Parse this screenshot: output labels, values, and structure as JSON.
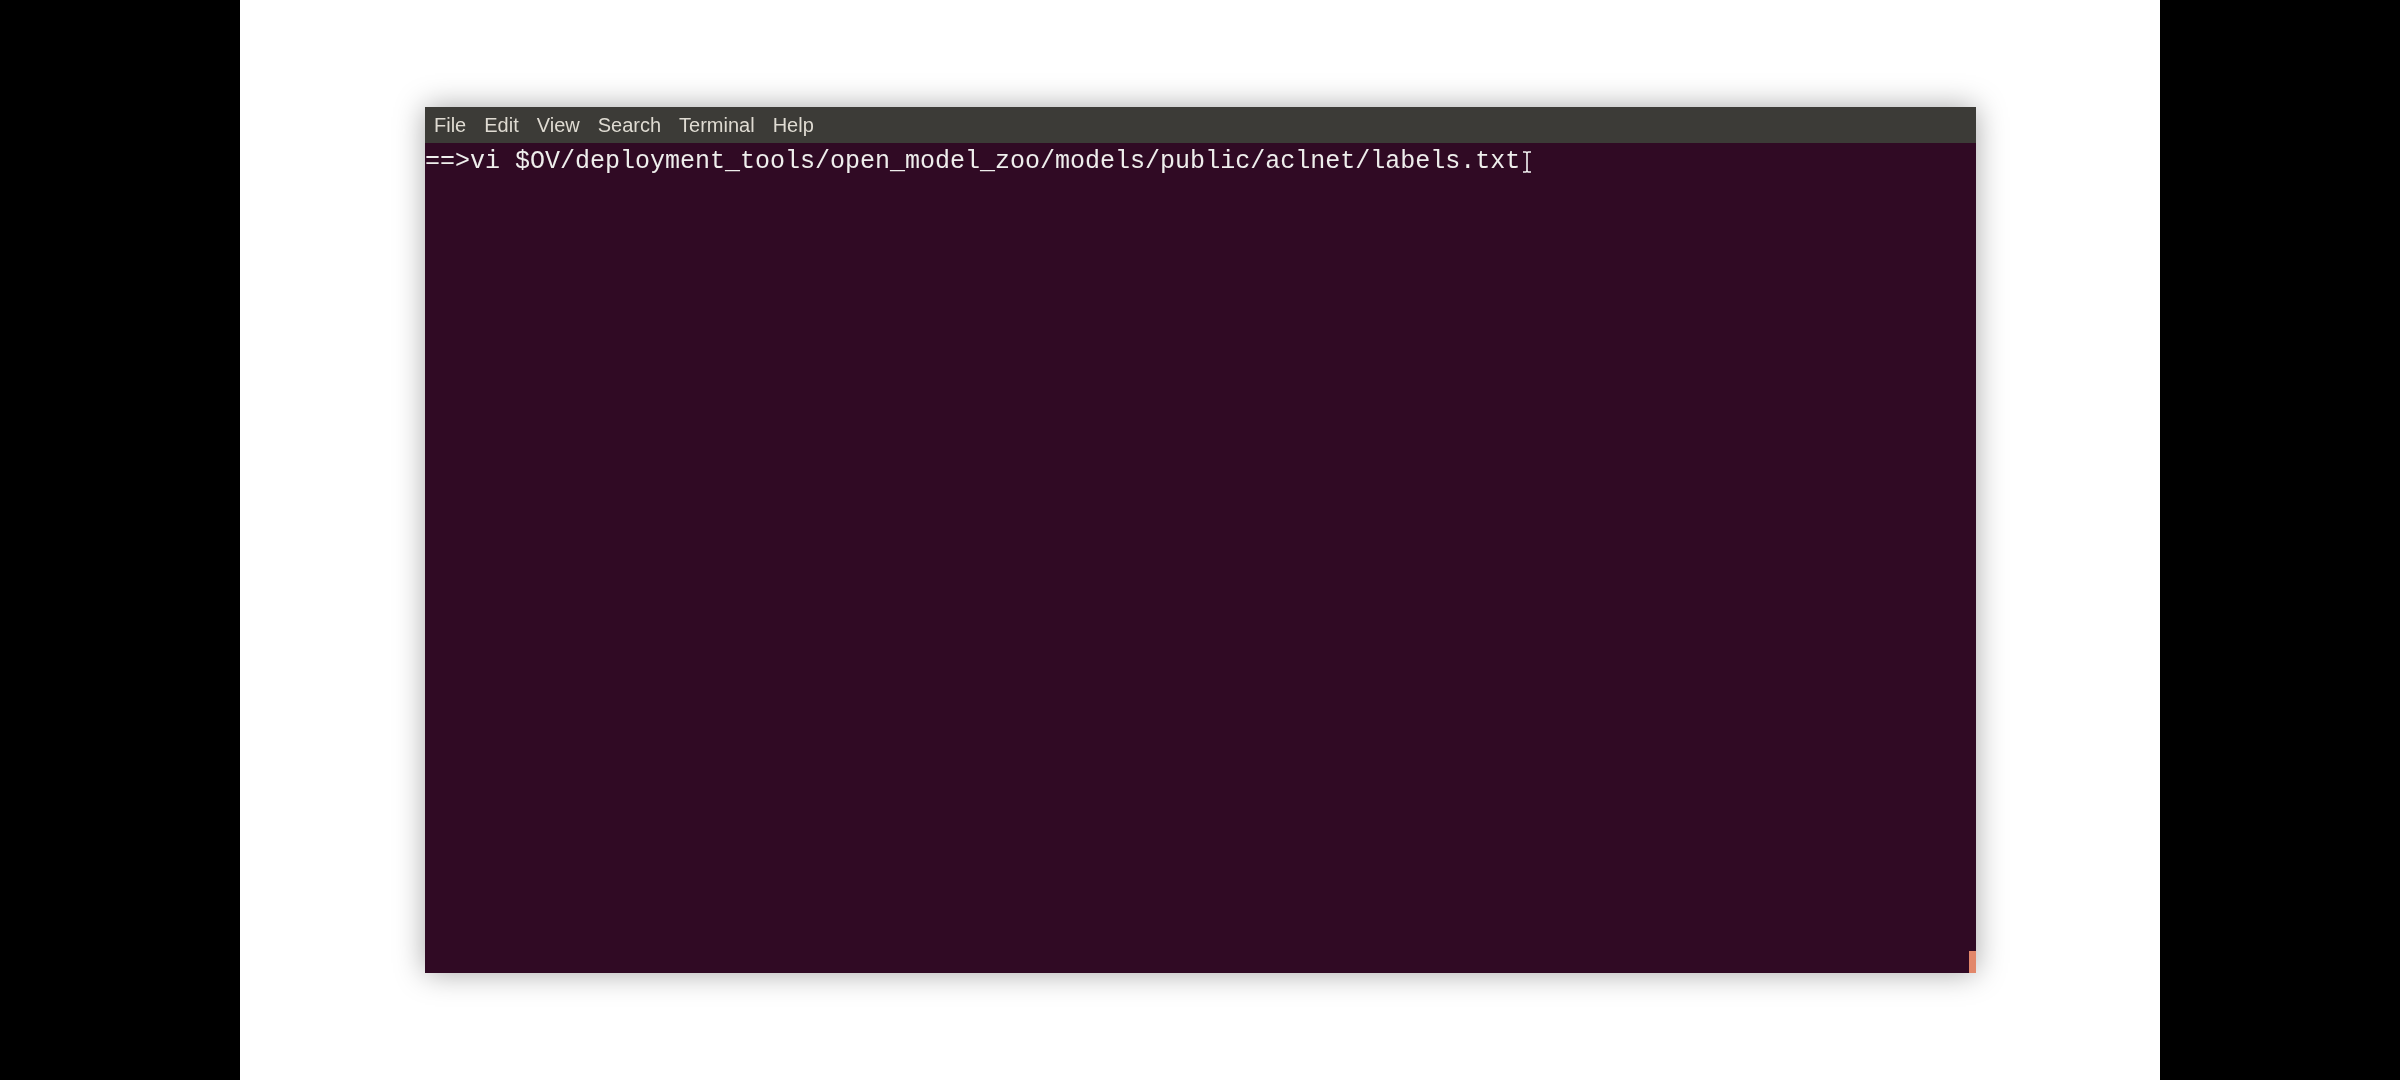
{
  "menu_bar": {
    "items": [
      "File",
      "Edit",
      "View",
      "Search",
      "Terminal",
      "Help"
    ]
  },
  "terminal": {
    "lines": [
      "==>vi $OV/deployment_tools/open_model_zoo/models/public/aclnet/labels.txt"
    ]
  }
}
